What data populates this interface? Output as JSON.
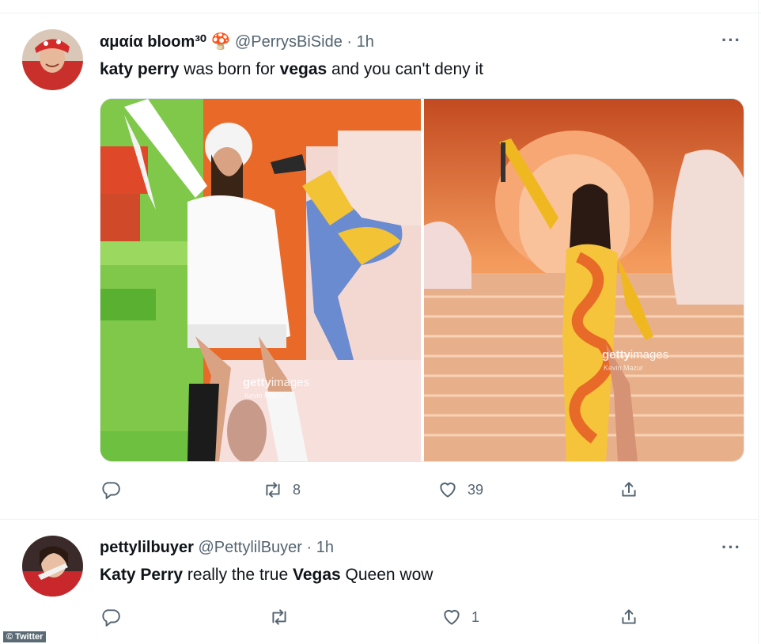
{
  "tweets": [
    {
      "display_name": "αμαία bloom³⁰",
      "emoji": "🍄",
      "handle": "@PerrysBiSide",
      "sep": "·",
      "time": "1h",
      "text_parts": [
        "katy perry",
        " was born for ",
        "vegas",
        " and you can't deny it"
      ],
      "media": [
        {
          "watermark_brand": "getty",
          "watermark_word": "images",
          "credit": "Kevin Mazur"
        },
        {
          "watermark_brand": "getty",
          "watermark_word": "images",
          "credit": "Kevin Mazur"
        }
      ],
      "counts": {
        "reply": "",
        "retweet": "8",
        "like": "39"
      }
    },
    {
      "display_name": "pettylilbuyer",
      "handle": "@PettylilBuyer",
      "sep": "·",
      "time": "1h",
      "text_parts": [
        "Katy Perry",
        " really the true ",
        "Vegas",
        " Queen wow"
      ],
      "counts": {
        "reply": "",
        "retweet": "",
        "like": "1"
      }
    }
  ],
  "more_label": "···",
  "copyright": "© Twitter",
  "colors": {
    "text": "#0f1419",
    "secondary": "#536471",
    "divider": "#eff3f4"
  }
}
